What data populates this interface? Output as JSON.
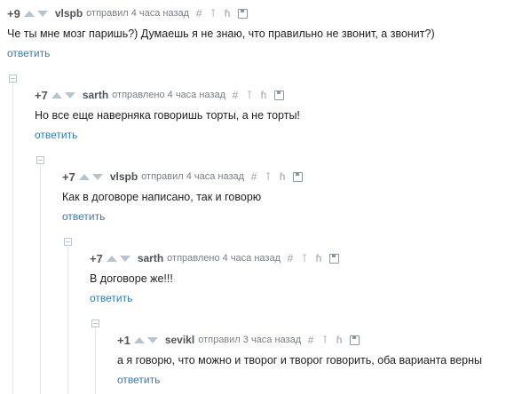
{
  "comments": [
    {
      "score": "+9",
      "author": "vlspb",
      "action": "отправил 4 часа назад",
      "text": "Че ты мне мозг паришь?) Думаешь я не знаю, что правильно не звонит, а звонит?)",
      "reply": "ответить"
    },
    {
      "score": "+7",
      "author": "sarth",
      "action": "отправлено 4 часа назад",
      "text": "Но все еще наверняка говоришь торты, а не торты!",
      "reply": "ответить"
    },
    {
      "score": "+7",
      "author": "vlspb",
      "action": "отправил 4 часа назад",
      "text": "Как в договоре написано, так и говорю",
      "reply": "ответить"
    },
    {
      "score": "+7",
      "author": "sarth",
      "action": "отправлено 4 часа назад",
      "text": "В договоре же!!!",
      "reply": "ответить"
    },
    {
      "score": "+1",
      "author": "sevikl",
      "action": "отправил 3 часа назад",
      "text": "а я говорю, что можно и творог и творог говорить, оба варианта верны",
      "reply": "ответить"
    }
  ],
  "icons": [
    "hash-icon",
    "pin-icon",
    "branch-icon",
    "save-icon"
  ]
}
